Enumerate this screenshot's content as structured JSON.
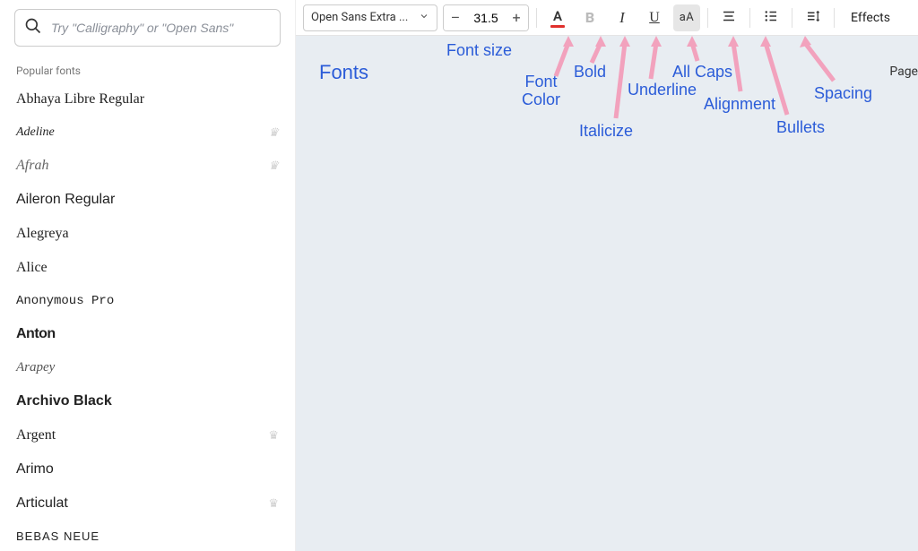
{
  "search": {
    "placeholder": "Try \"Calligraphy\" or \"Open Sans\""
  },
  "sidebar": {
    "section_label": "Popular fonts",
    "fonts": [
      {
        "name": "Abhaya Libre Regular",
        "cls": "f-abhaya",
        "premium": false
      },
      {
        "name": "Adeline",
        "cls": "f-adeline",
        "premium": true
      },
      {
        "name": "Afrah",
        "cls": "f-afrah",
        "premium": true
      },
      {
        "name": "Aileron Regular",
        "cls": "f-aileron",
        "premium": false
      },
      {
        "name": "Alegreya",
        "cls": "f-alegreya",
        "premium": false
      },
      {
        "name": "Alice",
        "cls": "f-alice",
        "premium": false
      },
      {
        "name": "Anonymous Pro",
        "cls": "f-anonymous",
        "premium": false
      },
      {
        "name": "Anton",
        "cls": "f-anton",
        "premium": false
      },
      {
        "name": "Arapey",
        "cls": "f-arapey",
        "premium": false
      },
      {
        "name": "Archivo Black",
        "cls": "f-archivo",
        "premium": false
      },
      {
        "name": "Argent",
        "cls": "f-argent",
        "premium": true
      },
      {
        "name": "Arimo",
        "cls": "f-arimo",
        "premium": false
      },
      {
        "name": "Articulat",
        "cls": "f-articulat",
        "premium": true
      },
      {
        "name": "BEBAS NEUE",
        "cls": "f-bebas",
        "premium": false
      }
    ]
  },
  "toolbar": {
    "font_name": "Open Sans Extra ...",
    "size_minus": "–",
    "font_size": "31.5",
    "size_plus": "+",
    "color_letter": "A",
    "bold_letter": "B",
    "italic_letter": "I",
    "underline_letter": "U",
    "caps_label": "aA",
    "effects_label": "Effects"
  },
  "annotations": {
    "fonts": "Fonts",
    "fontsize": "Font size",
    "fontcolor_l1": "Font",
    "fontcolor_l2": "Color",
    "bold": "Bold",
    "italicize": "Italicize",
    "underline": "Underline",
    "allcaps": "All Caps",
    "alignment": "Alignment",
    "bullets": "Bullets",
    "spacing": "Spacing",
    "page": "Page"
  },
  "colors": {
    "accent_red": "#e0302c",
    "annotation_blue": "#2b5cd8",
    "arrow_pink": "#f2a2bd"
  }
}
